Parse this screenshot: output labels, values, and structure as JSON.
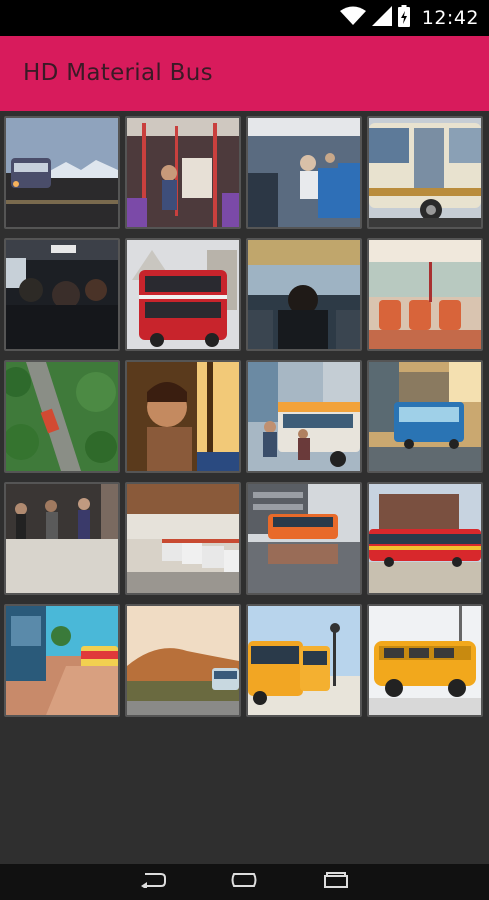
{
  "status_bar": {
    "time": "12:42",
    "icons": [
      "wifi-icon",
      "signal-icon",
      "battery-icon"
    ]
  },
  "app_bar": {
    "title": "HD Material Bus",
    "background_color": "#d81b5c"
  },
  "gallery": {
    "columns": 4,
    "images": [
      "bus-at-dusk-mountains",
      "bus-interior-aisle-passengers",
      "bus-interior-blue-seats",
      "white-coach-bus-side",
      "dark-bus-interior-passengers",
      "red-double-decker-bus",
      "bus-driver-view",
      "bus-interior-orange-seats",
      "aerial-road-bus-forest",
      "woman-window-sunlight",
      "city-bus-street-crowd",
      "blue-bus-city-street",
      "crowded-subway-station",
      "bus-depot-parked-buses",
      "bus-reflection-water",
      "red-yellow-bus-building",
      "bus-stop-street-scene",
      "landscape-van-hills",
      "yellow-buses-beach",
      "yellow-van-white-background"
    ]
  },
  "nav_bar": {
    "buttons": [
      "back-icon",
      "home-icon",
      "recents-icon"
    ]
  }
}
